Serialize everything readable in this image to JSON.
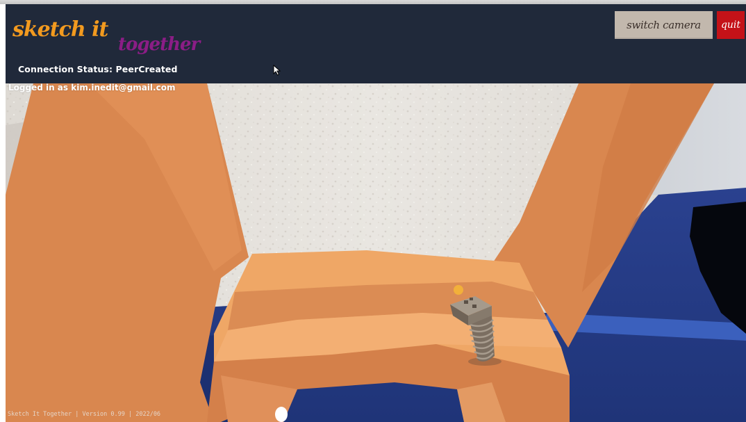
{
  "header": {
    "logo_primary": "sketch it",
    "logo_secondary": "together",
    "connection_status": "Connection Status: PeerCreated"
  },
  "toolbar": {
    "switch_camera_label": "switch camera",
    "quit_label": "quit"
  },
  "session": {
    "logged_in": "Logged in as kim.inedit@gmail.com"
  },
  "footer": {
    "version": "Sketch It Together | Version 0.99 | 2022/06"
  },
  "colors": {
    "header_bg": "#20293a",
    "logo_orange": "#f29a1f",
    "logo_cream": "#efe8d6",
    "logo_purple": "#8b1d86",
    "switch_button_bg": "#c2b8ad",
    "quit_button_bg": "#c41218",
    "sketch_orange": "#d9874f",
    "sketch_light_orange": "#efa766",
    "carpet_blue": "#283f8e"
  },
  "icons": {
    "cursor": "pointer-cursor-icon",
    "scene_object": "staircase-model-icon"
  }
}
